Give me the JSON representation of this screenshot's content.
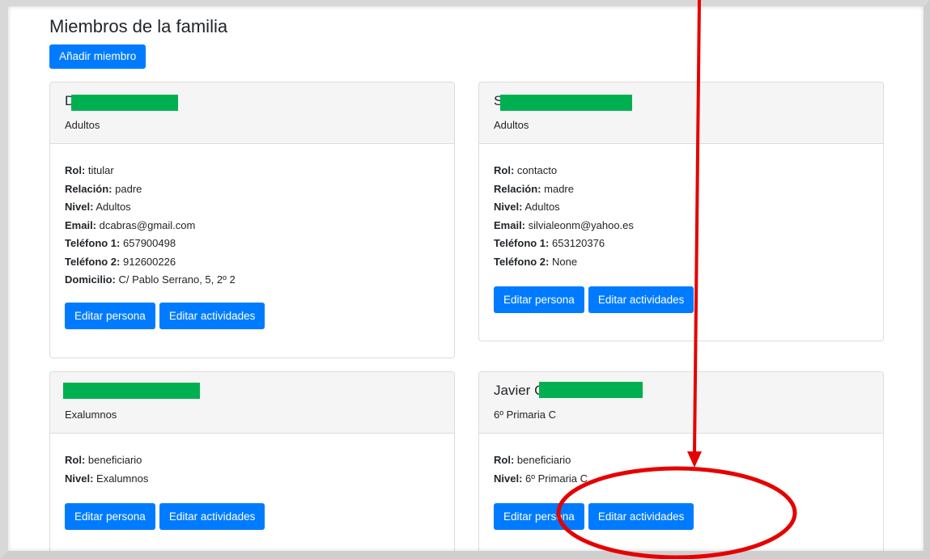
{
  "page": {
    "title": "Miembros de la familia",
    "add_button": "Añadir miembro"
  },
  "labels": {
    "rol": "Rol:",
    "relacion": "Relación:",
    "nivel": "Nivel:",
    "email": "Email:",
    "tel1": "Teléfono 1:",
    "tel2": "Teléfono 2:",
    "domicilio": "Domicilio:",
    "edit_person": "Editar persona",
    "edit_activities": "Editar actividades"
  },
  "members": [
    {
      "name_visible": "D",
      "group": "Adultos",
      "rol": "titular",
      "relacion": "padre",
      "nivel": "Adultos",
      "email": "dcabras@gmail.com",
      "tel1": "657900498",
      "tel2": "912600226",
      "domicilio": "C/ Pablo Serrano, 5, 2º 2"
    },
    {
      "name_visible": "S",
      "group": "Adultos",
      "rol": "contacto",
      "relacion": "madre",
      "nivel": "Adultos",
      "email": "silvialeonm@yahoo.es",
      "tel1": "653120376",
      "tel2": "None"
    },
    {
      "name_visible": "",
      "group": "Exalumnos",
      "rol": "beneficiario",
      "nivel": "Exalumnos"
    },
    {
      "name_visible": "Javier C",
      "group": "6º Primaria C",
      "rol": "beneficiario",
      "nivel": "6º Primaria C"
    }
  ],
  "colors": {
    "primary": "#007bff",
    "redaction": "#00b050",
    "annotation": "#e60000"
  }
}
